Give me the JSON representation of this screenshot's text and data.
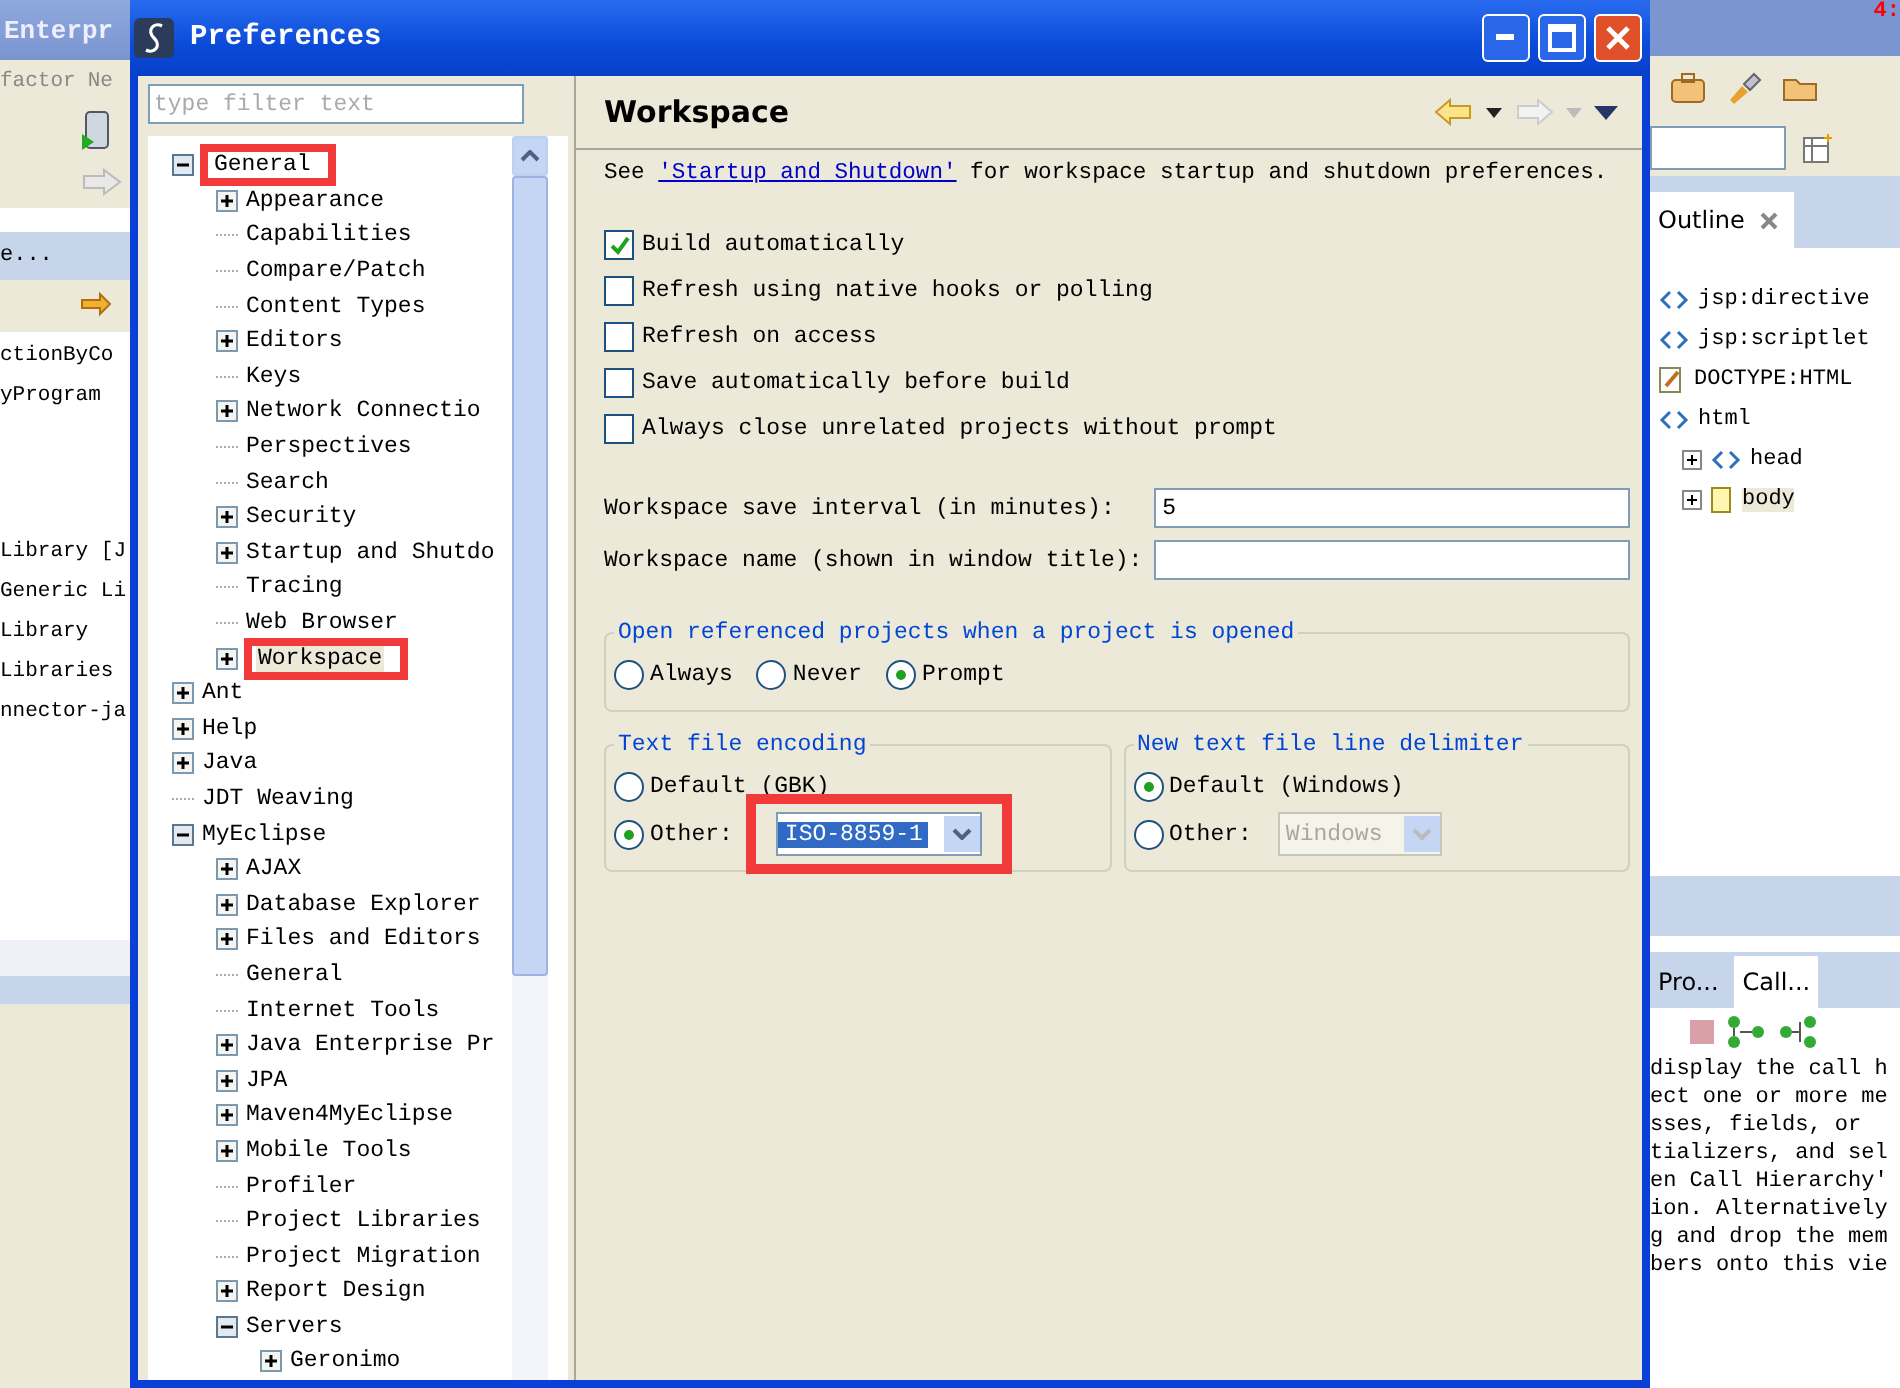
{
  "ide_left": {
    "title": "Enterpr",
    "menu": [
      "factor",
      "Ne"
    ],
    "view_tab": "e...",
    "items": [
      "ctionByCo",
      "yProgram",
      "Library [J",
      "Generic Li",
      "Library",
      "Libraries",
      "nnector-ja"
    ]
  },
  "dialog": {
    "title": "Preferences",
    "filter": {
      "placeholder": "type filter text"
    },
    "tree": [
      {
        "label": "General",
        "kind": "folder",
        "expanded": true,
        "selected": false,
        "annotated": true,
        "children": [
          {
            "label": "Appearance",
            "kind": "folder",
            "expanded": false,
            "selected": false,
            "annotated": false
          },
          {
            "label": "Capabilities",
            "kind": "leaf",
            "selected": false,
            "annotated": false
          },
          {
            "label": "Compare/Patch",
            "kind": "leaf",
            "selected": false,
            "annotated": false
          },
          {
            "label": "Content Types",
            "kind": "leaf",
            "selected": false,
            "annotated": false
          },
          {
            "label": "Editors",
            "kind": "folder",
            "expanded": false,
            "selected": false,
            "annotated": false
          },
          {
            "label": "Keys",
            "kind": "leaf",
            "selected": false,
            "annotated": false
          },
          {
            "label": "Network Connectio",
            "kind": "folder",
            "expanded": false,
            "selected": false,
            "annotated": false
          },
          {
            "label": "Perspectives",
            "kind": "leaf",
            "selected": false,
            "annotated": false
          },
          {
            "label": "Search",
            "kind": "leaf",
            "selected": false,
            "annotated": false
          },
          {
            "label": "Security",
            "kind": "folder",
            "expanded": false,
            "selected": false,
            "annotated": false
          },
          {
            "label": "Startup and Shutdo",
            "kind": "folder",
            "expanded": false,
            "selected": false,
            "annotated": false
          },
          {
            "label": "Tracing",
            "kind": "leaf",
            "selected": false,
            "annotated": false
          },
          {
            "label": "Web Browser",
            "kind": "leaf",
            "selected": false,
            "annotated": false
          },
          {
            "label": "Workspace",
            "kind": "folder",
            "expanded": false,
            "selected": true,
            "annotated": true
          }
        ]
      },
      {
        "label": "Ant",
        "kind": "folder",
        "expanded": false,
        "selected": false,
        "annotated": false
      },
      {
        "label": "Help",
        "kind": "folder",
        "expanded": false,
        "selected": false,
        "annotated": false
      },
      {
        "label": "Java",
        "kind": "folder",
        "expanded": false,
        "selected": false,
        "annotated": false
      },
      {
        "label": "JDT Weaving",
        "kind": "leaf",
        "selected": false,
        "annotated": false
      },
      {
        "label": "MyEclipse",
        "kind": "folder",
        "expanded": true,
        "selected": false,
        "annotated": false,
        "children": [
          {
            "label": "AJAX",
            "kind": "folder",
            "expanded": false,
            "selected": false,
            "annotated": false
          },
          {
            "label": "Database Explorer",
            "kind": "folder",
            "expanded": false,
            "selected": false,
            "annotated": false
          },
          {
            "label": "Files and Editors",
            "kind": "folder",
            "expanded": false,
            "selected": false,
            "annotated": false
          },
          {
            "label": "General",
            "kind": "leaf",
            "selected": false,
            "annotated": false
          },
          {
            "label": "Internet Tools",
            "kind": "leaf",
            "selected": false,
            "annotated": false
          },
          {
            "label": "Java Enterprise Pr",
            "kind": "folder",
            "expanded": false,
            "selected": false,
            "annotated": false
          },
          {
            "label": "JPA",
            "kind": "folder",
            "expanded": false,
            "selected": false,
            "annotated": false
          },
          {
            "label": "Maven4MyEclipse",
            "kind": "folder",
            "expanded": false,
            "selected": false,
            "annotated": false
          },
          {
            "label": "Mobile Tools",
            "kind": "folder",
            "expanded": false,
            "selected": false,
            "annotated": false
          },
          {
            "label": "Profiler",
            "kind": "leaf",
            "selected": false,
            "annotated": false
          },
          {
            "label": "Project Libraries",
            "kind": "leaf",
            "selected": false,
            "annotated": false
          },
          {
            "label": "Project Migration",
            "kind": "leaf",
            "selected": false,
            "annotated": false
          },
          {
            "label": "Report Design",
            "kind": "folder",
            "expanded": false,
            "selected": false,
            "annotated": false
          },
          {
            "label": "Servers",
            "kind": "folder",
            "expanded": true,
            "selected": false,
            "annotated": false,
            "children": [
              {
                "label": "Geronimo",
                "kind": "folder",
                "expanded": false,
                "selected": false,
                "annotated": false
              }
            ]
          }
        ]
      }
    ],
    "page_title": "Workspace",
    "intro": {
      "before": "See",
      "link": "'Startup and Shutdown'",
      "after": "for workspace startup and shutdown preferences."
    },
    "checkboxes": [
      {
        "label": "Build automatically",
        "checked": true
      },
      {
        "label": "Refresh using native hooks or polling",
        "checked": false
      },
      {
        "label": "Refresh on access",
        "checked": false
      },
      {
        "label": "Save automatically before build",
        "checked": false
      },
      {
        "label": "Always close unrelated projects without prompt",
        "checked": false
      }
    ],
    "fields": [
      {
        "label": "Workspace save interval (in minutes):",
        "value": "5"
      },
      {
        "label": "Workspace name (shown in window title):"
      }
    ],
    "open_projects": {
      "title": "Open referenced projects when a project is opened",
      "options": [
        {
          "label": "Always",
          "selected": false
        },
        {
          "label": "Never",
          "selected": false
        },
        {
          "label": "Prompt",
          "selected": true
        }
      ]
    },
    "encoding": {
      "title": "Text file encoding",
      "default_option": {
        "label": "Default (GBK)",
        "selected": false
      },
      "other_option": {
        "label": "Other:",
        "selected": true
      },
      "combo": {
        "value": "ISO-8859-1",
        "disabled": false,
        "annotated": true
      }
    },
    "delimiter": {
      "title": "New text file line delimiter",
      "default_option": {
        "label": "Default (Windows)",
        "selected": true
      },
      "other_option": {
        "label": "Other:",
        "selected": false
      },
      "combo": {
        "value": "Windows",
        "disabled": true,
        "annotated": false
      }
    }
  },
  "ide_right": {
    "badge": "4:",
    "outline_tab": "Outline",
    "outline": [
      {
        "label": "jsp:directive",
        "kind": "tag",
        "selected": false
      },
      {
        "label": "jsp:scriptlet",
        "kind": "tag",
        "selected": false
      },
      {
        "label": "DOCTYPE:HTML",
        "kind": "doctype",
        "selected": false
      },
      {
        "label": "html",
        "kind": "tag",
        "selected": false,
        "children": [
          {
            "label": "head",
            "kind": "tag",
            "selected": false,
            "expanded": false
          },
          {
            "label": "body",
            "kind": "page",
            "selected": true,
            "expanded": false
          }
        ]
      }
    ],
    "tabs": [
      {
        "label": "Pro...",
        "selected": false
      },
      {
        "label": "Call...",
        "selected": true
      }
    ],
    "help_lines": [
      "display the call h",
      "ect one or more me",
      "sses, fields, or",
      "tializers, and sel",
      "en Call Hierarchy'",
      "ion. Alternatively",
      "g and drop the mem",
      "bers onto this vie"
    ]
  }
}
